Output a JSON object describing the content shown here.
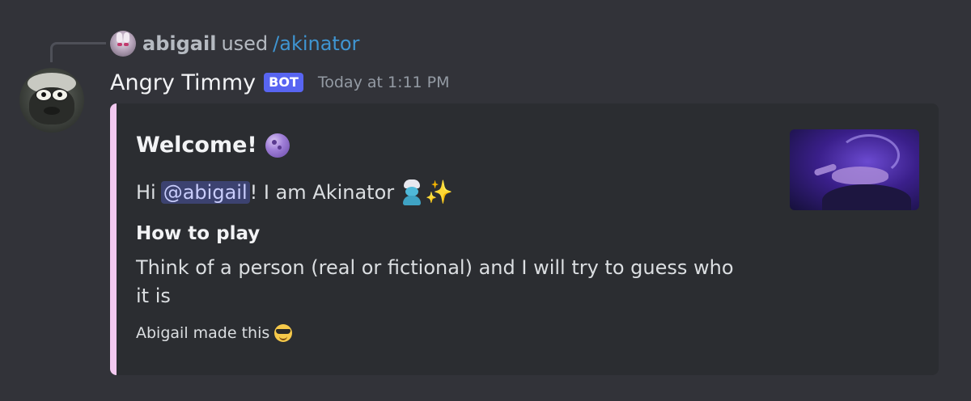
{
  "reply": {
    "user": "abigail",
    "action": "used",
    "command": "/akinator"
  },
  "message": {
    "author": "Angry Timmy",
    "bot_tag": "BOT",
    "timestamp": "Today at 1:11 PM"
  },
  "embed": {
    "accent_color": "#f3c9f0",
    "title": "Welcome!",
    "title_icon": "crystal-ball-icon",
    "description_prefix": "Hi",
    "mention": "@abigail",
    "description_suffix": "! I am Akinator",
    "description_icons": [
      "genie-icon",
      "sparkles-icon"
    ],
    "field": {
      "name": "How to play",
      "value": "Think of a person (real or fictional) and I will try to guess who it is"
    },
    "footer": "Abigail made this",
    "footer_icon": "sunglasses-face-icon",
    "thumbnail": "magic-lamp-image"
  },
  "colors": {
    "background": "#323339",
    "embed_background": "#2b2d31",
    "bot_tag": "#5865f2",
    "command_link": "#3f95d2",
    "mention_bg": "#3c4270"
  }
}
